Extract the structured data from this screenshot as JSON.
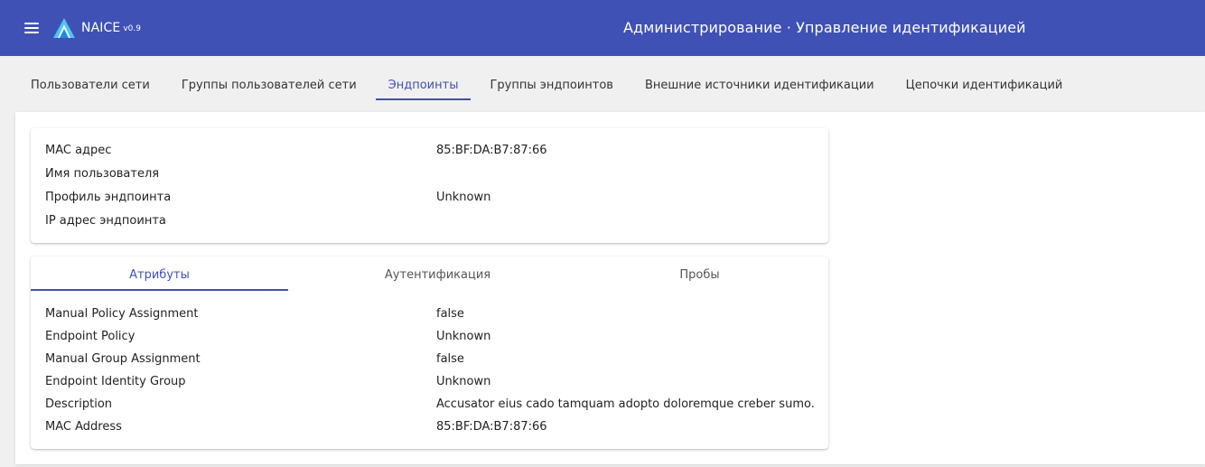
{
  "header": {
    "app_name": "NAICE",
    "app_version": "v0.9",
    "title": "Администрирование · Управление идентификацией",
    "background": "#3f51b5",
    "icons": {
      "menu": "hamburger-menu-icon",
      "logo": "naice-logo"
    }
  },
  "nav_tabs": [
    {
      "label": "Пользователи сети"
    },
    {
      "label": "Группы пользователей сети"
    },
    {
      "label": "Эндпоинты",
      "active": true
    },
    {
      "label": "Группы эндпоинтов"
    },
    {
      "label": "Внешние источники идентификации"
    },
    {
      "label": "Цепочки идентификаций"
    }
  ],
  "summary": {
    "mac_label": "MAC адрес",
    "mac_value": "85:BF:DA:B7:87:66",
    "username_label": "Имя пользователя",
    "username_value": "",
    "profile_label": "Профиль эндпоинта",
    "profile_value": "Unknown",
    "ip_label": "IP адрес эндпоинта",
    "ip_value": ""
  },
  "detail_tabs": [
    {
      "label": "Атрибуты",
      "active": true
    },
    {
      "label": "Аутентификация"
    },
    {
      "label": "Пробы"
    }
  ],
  "attributes": [
    {
      "name": "Manual Policy Assignment",
      "value": "false"
    },
    {
      "name": "Endpoint Policy",
      "value": "Unknown"
    },
    {
      "name": "Manual Group Assignment",
      "value": "false"
    },
    {
      "name": "Endpoint Identity Group",
      "value": "Unknown"
    },
    {
      "name": "Description",
      "value": "Accusator eius cado tamquam adopto doloremque creber sumo."
    },
    {
      "name": "MAC Address",
      "value": "85:BF:DA:B7:87:66"
    }
  ],
  "colors": {
    "accent": "#3f51b5",
    "page_bg": "#f0f0f0"
  }
}
